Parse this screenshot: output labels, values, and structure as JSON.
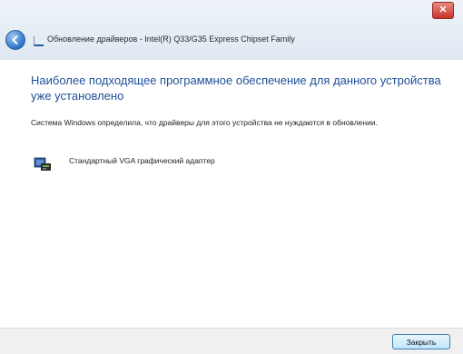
{
  "window": {
    "title": "Обновление драйверов - Intel(R) Q33/G35 Express Chipset Family",
    "close_glyph": "✕"
  },
  "content": {
    "heading": "Наиболее подходящее программное обеспечение для данного устройства уже установлено",
    "message": "Система Windows определила, что драйверы для этого устройства не нуждаются в обновлении.",
    "device_name": "Стандартный VGA графический адаптер"
  },
  "footer": {
    "close_label": "Закрыть"
  },
  "colors": {
    "heading": "#1e4f99",
    "button_border": "#3c7fb1"
  },
  "icons": [
    "back-arrow-icon",
    "display-adapter-icon",
    "close-icon"
  ]
}
